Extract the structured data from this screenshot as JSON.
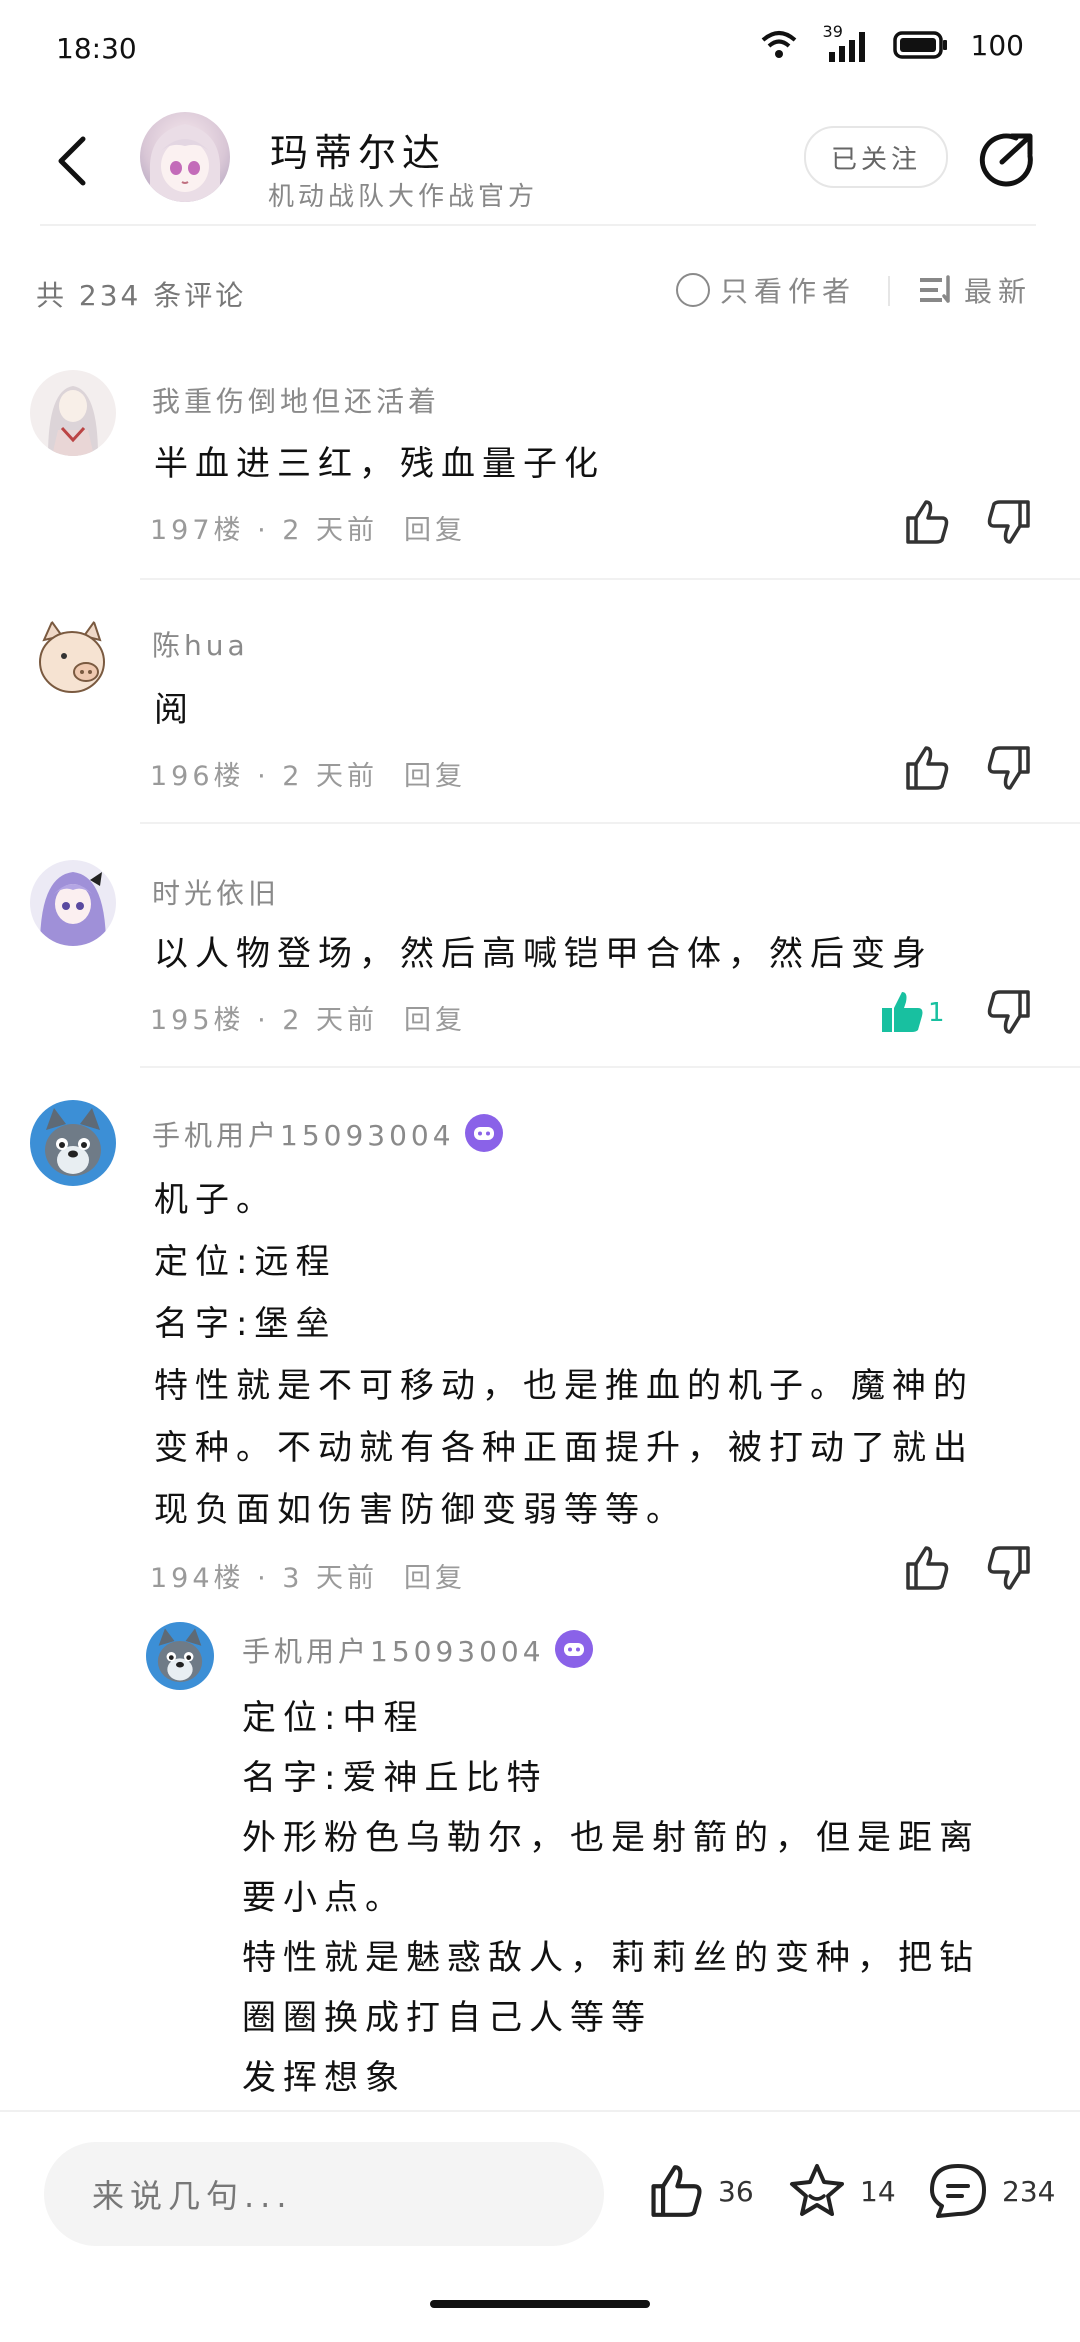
{
  "status_bar": {
    "time": "18:30",
    "signal_label": "39",
    "battery": "100"
  },
  "header": {
    "title": "玛蒂尔达",
    "subtitle": "机动战队大作战官方",
    "follow_label": "已关注"
  },
  "sort_bar": {
    "total_label": "共 234 条评论",
    "only_author_label": "只看作者",
    "sort_label": "最新"
  },
  "comments": [
    {
      "username": "我重伤倒地但还活着",
      "lines": [
        "半血进三红，残血量子化"
      ],
      "meta": "197楼 · 2 天前",
      "reply_label": "回复"
    },
    {
      "username": "陈hua",
      "lines": [
        "阅"
      ],
      "meta": "196楼 · 2 天前",
      "reply_label": "回复"
    },
    {
      "username": "时光依旧",
      "lines": [
        "以人物登场，然后高喊铠甲合体，然后变身"
      ],
      "meta": "195楼 · 2 天前",
      "reply_label": "回复",
      "like_count": "1"
    },
    {
      "username": "手机用户15093004",
      "lines": [
        "机子。",
        "定位:远程",
        "名字:堡垒",
        "特性就是不可移动，也是推血的机子。魔神的",
        "变种。不动就有各种正面提升，被打动了就出",
        "现负面如伤害防御变弱等等。"
      ],
      "meta": "194楼 · 3 天前",
      "reply_label": "回复"
    }
  ],
  "sub_reply": {
    "username": "手机用户15093004",
    "lines": [
      "定位:中程",
      "名字:爱神丘比特",
      "外形粉色乌勒尔，也是射箭的，但是距离",
      "要小点。",
      "特性就是魅惑敌人，莉莉丝的变种，把钻",
      "圈圈换成打自己人等等",
      "发挥想象"
    ]
  },
  "bottom_bar": {
    "input_placeholder": "来说几句...",
    "like_count": "36",
    "favorite_count": "14",
    "comment_count": "234"
  },
  "colors": {
    "accent": "#18c0a0",
    "badge": "#8a62e8",
    "muted": "#8a8a8a"
  }
}
